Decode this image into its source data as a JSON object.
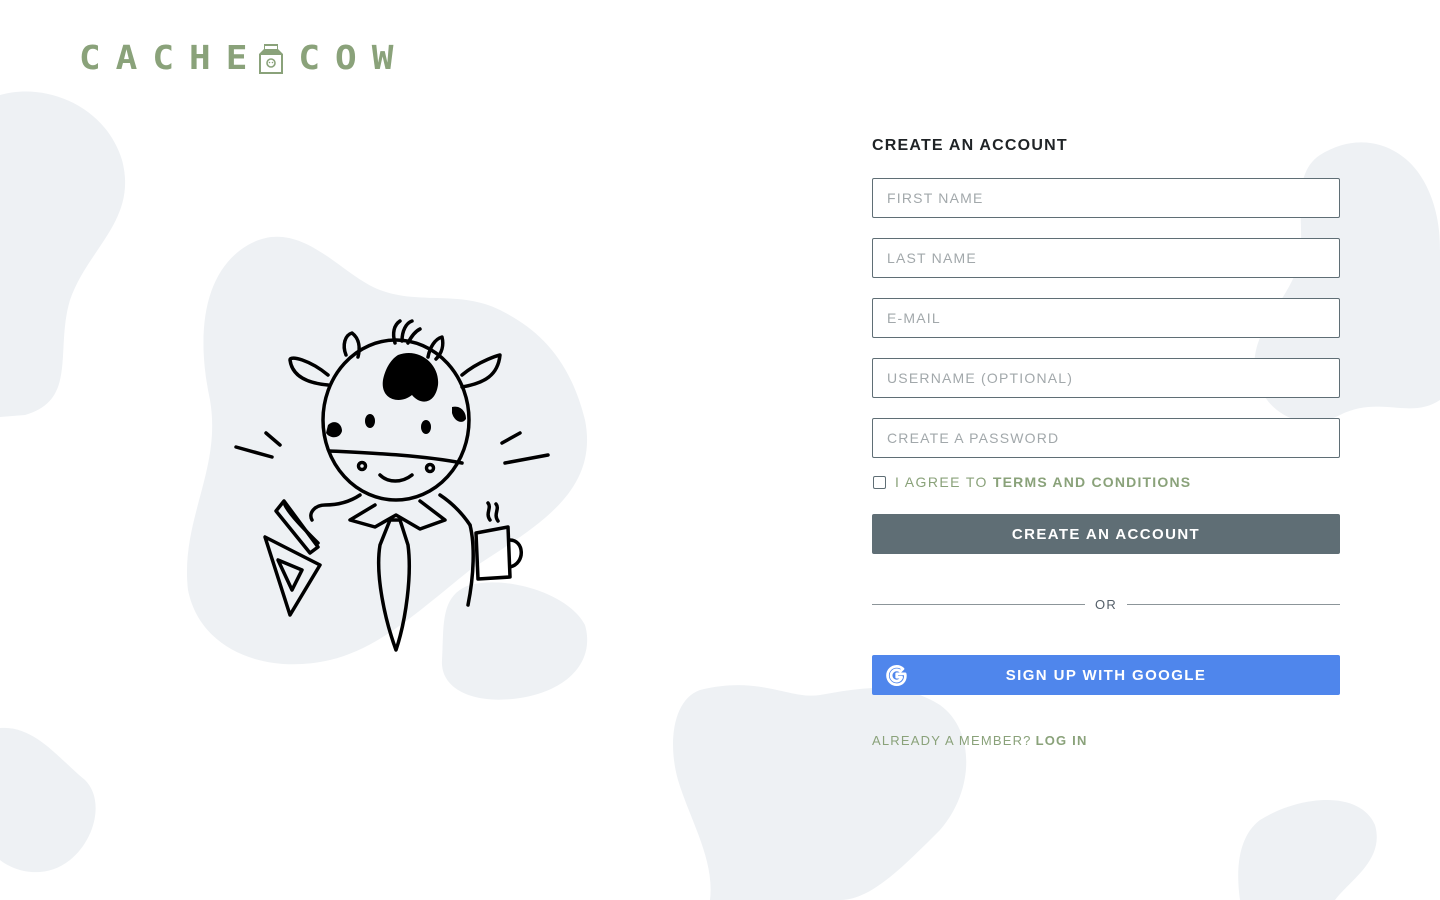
{
  "brand": {
    "name_left": "CACHE",
    "name_right": "COW",
    "accent_color": "#8aa27a"
  },
  "illustration": {
    "icon": "cow-mascot-icon"
  },
  "signup_form": {
    "title": "CREATE AN ACCOUNT",
    "fields": {
      "first_name": "FIRST NAME",
      "last_name": "LAST NAME",
      "email": "E-MAIL",
      "username": "USERNAME (OPTIONAL)",
      "password": "CREATE A PASSWORD"
    },
    "agree_prefix": "I AGREE TO",
    "agree_link": "TERMS AND CONDITIONS",
    "submit_label": "CREATE AN ACCOUNT",
    "divider_text": "OR",
    "google_label": "SIGN UP WITH GOOGLE",
    "member_prompt": "ALREADY A MEMBER?",
    "login_link": "LOG IN"
  },
  "colors": {
    "primary_button": "#5f6e75",
    "google_button": "#4f86ec",
    "blob": "#eef1f4",
    "heading": "#1f2326"
  }
}
